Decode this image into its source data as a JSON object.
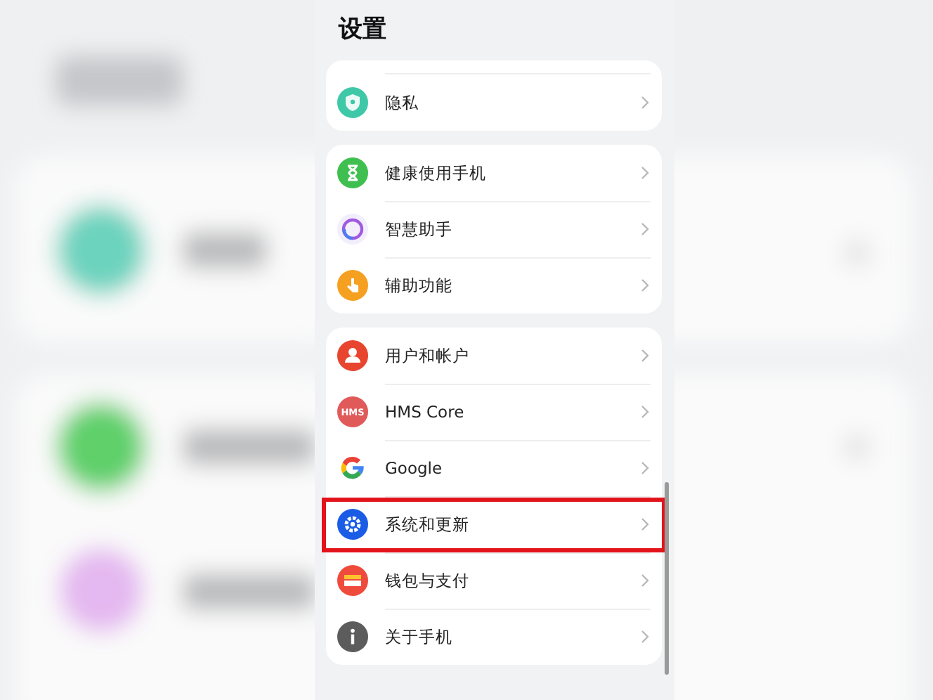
{
  "title": "设置",
  "groups": [
    {
      "items": [
        {
          "label": "隐私",
          "highlighted": false
        }
      ]
    },
    {
      "items": [
        {
          "label": "健康使用手机",
          "highlighted": false
        },
        {
          "label": "智慧助手",
          "highlighted": false
        },
        {
          "label": "辅助功能",
          "highlighted": false
        }
      ]
    },
    {
      "items": [
        {
          "label": "用户和帐户",
          "highlighted": false
        },
        {
          "label": "HMS Core",
          "icon_text": "HMS",
          "highlighted": false
        },
        {
          "label": "Google",
          "highlighted": false
        },
        {
          "label": "系统和更新",
          "highlighted": true
        },
        {
          "label": "钱包与支付",
          "highlighted": false
        },
        {
          "label": "关于手机",
          "highlighted": false
        }
      ]
    }
  ]
}
